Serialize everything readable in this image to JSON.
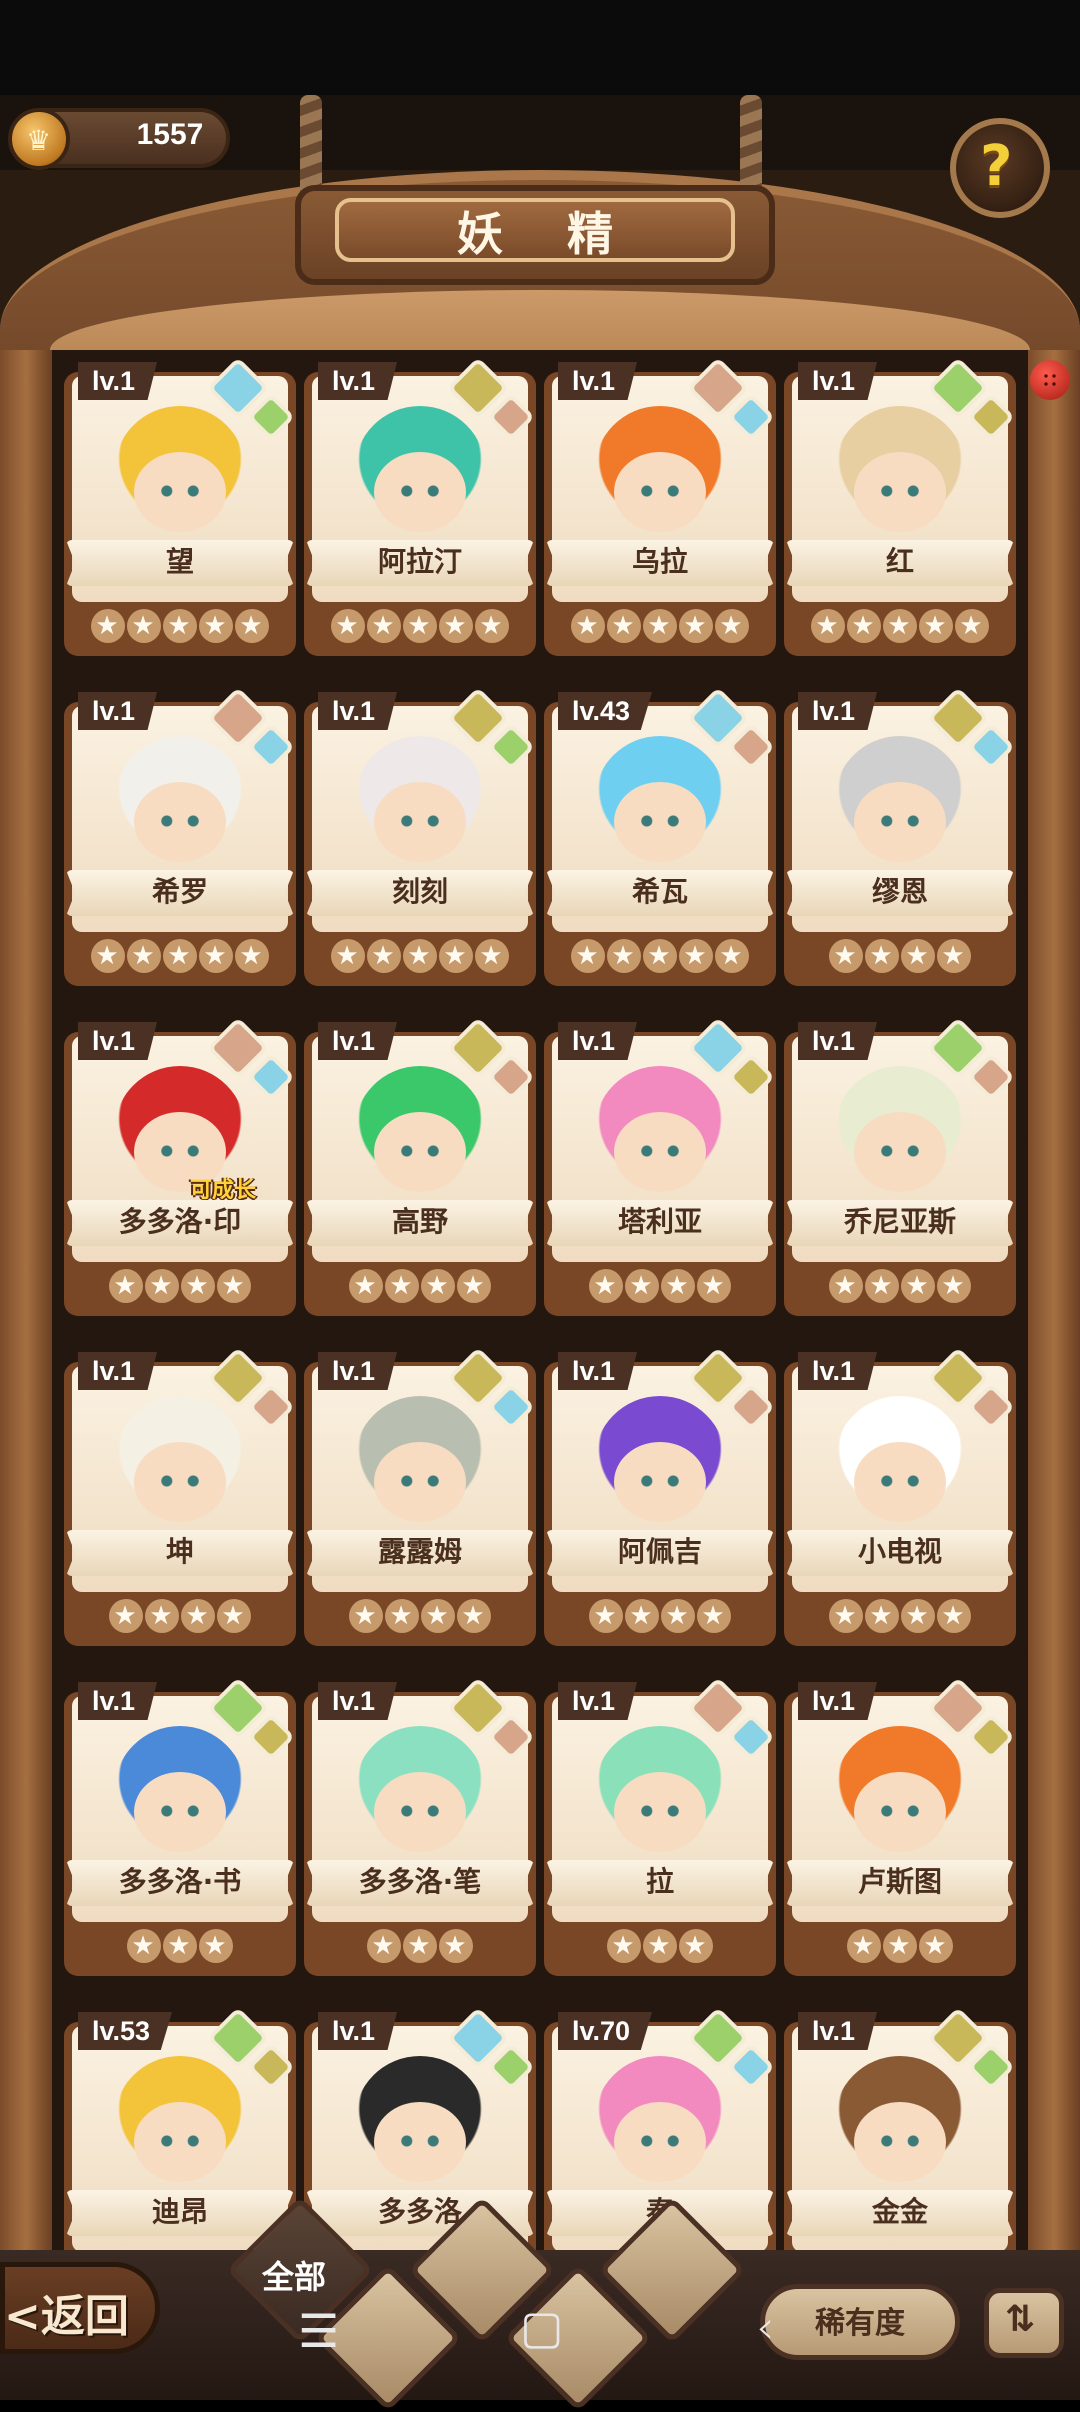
{
  "header": {
    "coin_value": "1557",
    "coin_icon": "crown-coin-icon",
    "title": "妖 精",
    "help_label": "?"
  },
  "cards": [
    {
      "level": "lv.1",
      "name": "望",
      "stars": "★★★★★",
      "hair": "#f3c33a",
      "elem1": "#8ad2e6",
      "elem2": "#9bd06a"
    },
    {
      "level": "lv.1",
      "name": "阿拉汀",
      "stars": "★★★★★",
      "hair": "#3fc3a8",
      "elem1": "#c8b85a",
      "elem2": "#d6a58a"
    },
    {
      "level": "lv.1",
      "name": "乌拉",
      "stars": "★★★★★",
      "hair": "#f07a2a",
      "elem1": "#d6a58a",
      "elem2": "#8ad2e6"
    },
    {
      "level": "lv.1",
      "name": "红",
      "stars": "★★★★★",
      "hair": "#e8cfa2",
      "elem1": "#9bd06a",
      "elem2": "#c8b85a"
    },
    {
      "level": "lv.1",
      "name": "希罗",
      "stars": "★★★★★",
      "hair": "#f2f0ea",
      "elem1": "#d6a58a",
      "elem2": "#8ad2e6"
    },
    {
      "level": "lv.1",
      "name": "刻刻",
      "stars": "★★★★★",
      "hair": "#efe8e8",
      "elem1": "#c8b85a",
      "elem2": "#9bd06a"
    },
    {
      "level": "lv.43",
      "name": "希瓦",
      "stars": "★★★★★",
      "hair": "#6fcff0",
      "elem1": "#8ad2e6",
      "elem2": "#d6a58a"
    },
    {
      "level": "lv.1",
      "name": "缪恩",
      "stars": "★★★★",
      "hair": "#cfcfcf",
      "elem1": "#c8b85a",
      "elem2": "#8ad2e6"
    },
    {
      "level": "lv.1",
      "name": "多多洛·印",
      "stars": "★★★★",
      "hair": "#d42a2a",
      "elem1": "#d6a58a",
      "elem2": "#8ad2e6",
      "badge": "可成长"
    },
    {
      "level": "lv.1",
      "name": "高野",
      "stars": "★★★★",
      "hair": "#3ac86a",
      "elem1": "#c8b85a",
      "elem2": "#d6a58a"
    },
    {
      "level": "lv.1",
      "name": "塔利亚",
      "stars": "★★★★",
      "hair": "#f28ac0",
      "elem1": "#8ad2e6",
      "elem2": "#c8b85a"
    },
    {
      "level": "lv.1",
      "name": "乔尼亚斯",
      "stars": "★★★★",
      "hair": "#e8ecd0",
      "elem1": "#9bd06a",
      "elem2": "#d6a58a"
    },
    {
      "level": "lv.1",
      "name": "坤",
      "stars": "★★★★",
      "hair": "#f4f0e4",
      "elem1": "#c8b85a",
      "elem2": "#d6a58a"
    },
    {
      "level": "lv.1",
      "name": "露露姆",
      "stars": "★★★★",
      "hair": "#b9bfb0",
      "elem1": "#c8b85a",
      "elem2": "#8ad2e6"
    },
    {
      "level": "lv.1",
      "name": "阿佩吉",
      "stars": "★★★★",
      "hair": "#7a4ad0",
      "elem1": "#c8b85a",
      "elem2": "#d6a58a"
    },
    {
      "level": "lv.1",
      "name": "小电视",
      "stars": "★★★★",
      "hair": "#ffffff",
      "elem1": "#c8b85a",
      "elem2": "#d6a58a"
    },
    {
      "level": "lv.1",
      "name": "多多洛·书",
      "stars": "★★★",
      "hair": "#4a8ad8",
      "elem1": "#9bd06a",
      "elem2": "#c8b85a"
    },
    {
      "level": "lv.1",
      "name": "多多洛·笔",
      "stars": "★★★",
      "hair": "#8ae0c0",
      "elem1": "#c8b85a",
      "elem2": "#d6a58a"
    },
    {
      "level": "lv.1",
      "name": "拉",
      "stars": "★★★",
      "hair": "#8ae0b8",
      "elem1": "#d6a58a",
      "elem2": "#8ad2e6"
    },
    {
      "level": "lv.1",
      "name": "卢斯图",
      "stars": "★★★",
      "hair": "#f07a2a",
      "elem1": "#d6a58a",
      "elem2": "#c8b85a"
    },
    {
      "level": "lv.53",
      "name": "迪昂",
      "stars": "",
      "hair": "#f3c33a",
      "elem1": "#9bd06a",
      "elem2": "#c8b85a"
    },
    {
      "level": "lv.1",
      "name": "多多洛",
      "stars": "",
      "hair": "#2a2a2a",
      "elem1": "#8ad2e6",
      "elem2": "#9bd06a"
    },
    {
      "level": "lv.70",
      "name": "泰",
      "stars": "",
      "hair": "#f28ac0",
      "elem1": "#9bd06a",
      "elem2": "#8ad2e6"
    },
    {
      "level": "lv.1",
      "name": "金金",
      "stars": "",
      "hair": "#8a5a35",
      "elem1": "#c8b85a",
      "elem2": "#9bd06a"
    }
  ],
  "footer": {
    "back_label": "返回",
    "filter_all": "全部",
    "rarity_label": "稀有度",
    "sort_icon": "sort-icon"
  }
}
